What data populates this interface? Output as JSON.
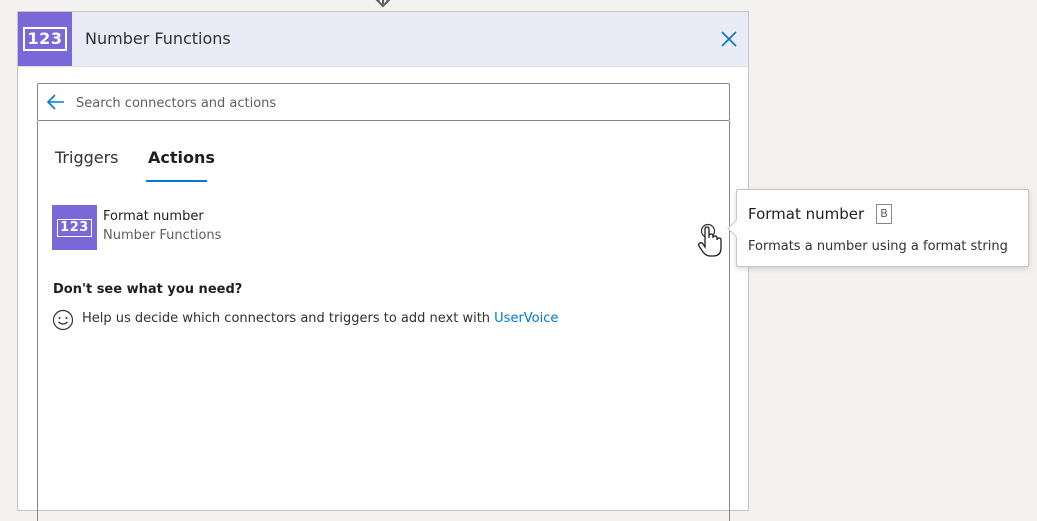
{
  "header": {
    "logo_text": "123",
    "title": "Number Functions",
    "accent_color": "#7b68d8"
  },
  "search": {
    "placeholder": "Search connectors and actions",
    "value": ""
  },
  "tabs": [
    {
      "label": "Triggers",
      "active": false
    },
    {
      "label": "Actions",
      "active": true
    }
  ],
  "actions": [
    {
      "icon_text": "123",
      "name": "Format number",
      "connector": "Number Functions"
    }
  ],
  "help": {
    "heading": "Don't see what you need?",
    "text": "Help us decide which connectors and triggers to add next with ",
    "link_text": "UserVoice",
    "link_color": "#0078d4"
  },
  "tooltip": {
    "title": "Format number",
    "badge": "B",
    "description": "Formats a number using a format string"
  }
}
